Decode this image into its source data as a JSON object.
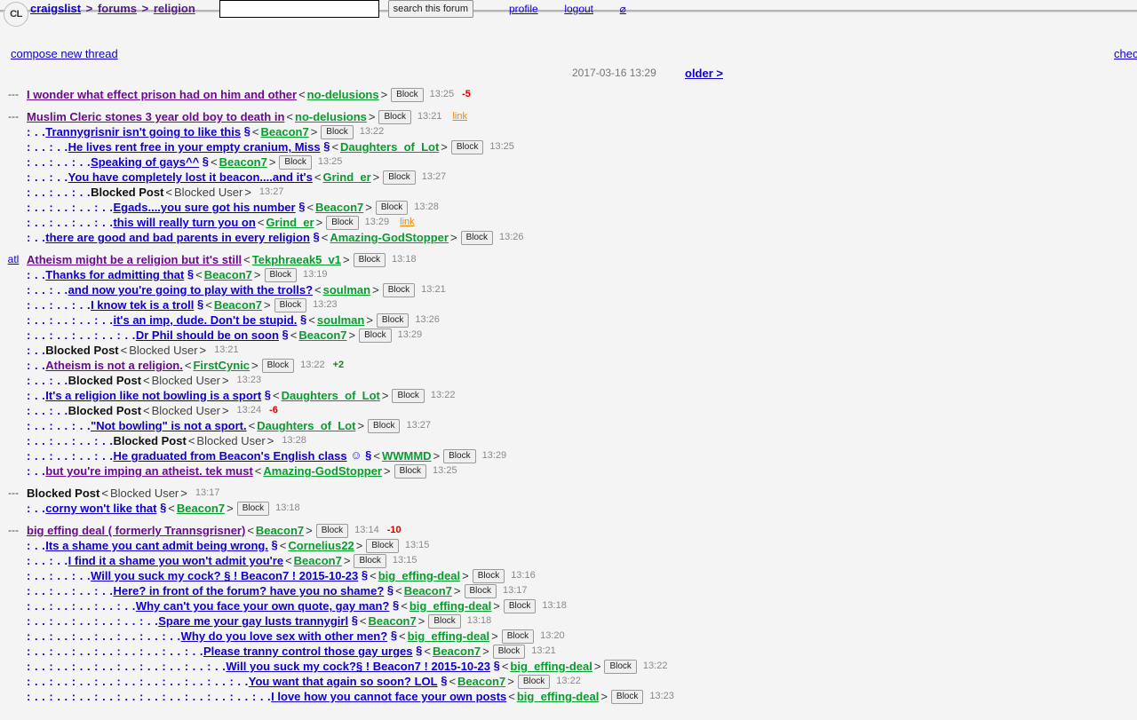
{
  "header": {
    "logo": "CL",
    "breadcrumbs": [
      {
        "label": "craigslist",
        "visited": false
      },
      {
        "label": "forums",
        "visited": true
      },
      {
        "label": "religion",
        "visited": true
      }
    ],
    "separator": ">",
    "search": {
      "value": "",
      "placeholder": "",
      "button_label": "search this forum"
    },
    "account_links": [
      {
        "label": "profile"
      },
      {
        "label": "logout"
      },
      {
        "label": "⌀"
      }
    ]
  },
  "subbar": {
    "compose_label": "compose new thread",
    "check_label": "chec",
    "timestamp": "2017-03-16 13:29",
    "older_label": "older >"
  },
  "glyphs": {
    "section": "§",
    "smiley": "☺",
    "open": "<",
    "close": ">",
    "block_label": "Block",
    "link_label": "link",
    "blocked_post": "Blocked Post",
    "blocked_user": "Blocked User",
    "dash": "---"
  },
  "threads": [
    {
      "posts": [
        {
          "flag": "---",
          "flag_link": false,
          "indent": "",
          "title": "I wonder what effect prison had on him and other",
          "visited": true,
          "section": false,
          "author": "no-delusions",
          "block": true,
          "time": "13:25",
          "score": "-5",
          "score_sign": "neg",
          "link": false
        }
      ]
    },
    {
      "posts": [
        {
          "flag": "---",
          "flag_link": false,
          "indent": "",
          "title": "Muslim Cleric stones 3 year old boy to death in",
          "visited": true,
          "section": false,
          "author": "no-delusions",
          "block": true,
          "time": "13:21",
          "score": "",
          "score_sign": "",
          "link": true
        },
        {
          "flag": "",
          "flag_link": false,
          "indent": ": . .",
          "title": "Trannygrisnir isn't going to like this",
          "visited": false,
          "section": true,
          "author": "Beacon7",
          "block": true,
          "time": "13:22",
          "score": "",
          "score_sign": "",
          "link": false
        },
        {
          "flag": "",
          "flag_link": false,
          "indent": ": . . : . .",
          "title": "He lives rent free in your empty cranium, Miss",
          "visited": false,
          "section": true,
          "author": "Daughters_of_Lot",
          "block": true,
          "time": "13:25",
          "score": "",
          "score_sign": "",
          "link": false
        },
        {
          "flag": "",
          "flag_link": false,
          "indent": ": . . : . . : . .",
          "title": "Speaking of gays^^",
          "visited": false,
          "section": true,
          "author": "Beacon7",
          "block": true,
          "time": "13:25",
          "score": "",
          "score_sign": "",
          "link": false
        },
        {
          "flag": "",
          "flag_link": false,
          "indent": ": . . : . .",
          "title": "You have completely lost it beacon....and it's",
          "visited": false,
          "section": false,
          "author": "Grind_er",
          "block": true,
          "time": "13:27",
          "score": "",
          "score_sign": "",
          "link": false
        },
        {
          "flag": "",
          "flag_link": false,
          "indent": ": . . : . . : . .",
          "title": "Blocked Post",
          "blocked": true,
          "visited": false,
          "section": false,
          "author": "Blocked User",
          "block": false,
          "time": "13:27",
          "score": "",
          "score_sign": "",
          "link": false
        },
        {
          "flag": "",
          "flag_link": false,
          "indent": ": . . : . . : . . : . .",
          "title": "Egads....you sure got his number",
          "visited": false,
          "section": true,
          "author": "Beacon7",
          "block": true,
          "time": "13:28",
          "score": "",
          "score_sign": "",
          "link": false
        },
        {
          "flag": "",
          "flag_link": false,
          "indent": ": . . : . . : . . : . .",
          "title": "this will really turn you on",
          "visited": false,
          "section": false,
          "author": "Grind_er",
          "block": true,
          "time": "13:29",
          "score": "",
          "score_sign": "",
          "link": true
        },
        {
          "flag": "",
          "flag_link": false,
          "indent": ": . .",
          "title": "there are good and bad parents in every religion",
          "visited": false,
          "section": true,
          "author": "Amazing-GodStopper",
          "block": true,
          "time": "13:26",
          "score": "",
          "score_sign": "",
          "link": false
        }
      ]
    },
    {
      "posts": [
        {
          "flag": "atl",
          "flag_link": true,
          "indent": "",
          "title": "Atheism might be a religion but it's still",
          "visited": true,
          "section": false,
          "author": "Tekphraeak5_v1",
          "block": true,
          "time": "13:18",
          "score": "",
          "score_sign": "",
          "link": false
        },
        {
          "flag": "",
          "flag_link": false,
          "indent": ": . .",
          "title": "Thanks for admitting that",
          "visited": false,
          "section": true,
          "author": "Beacon7",
          "block": true,
          "time": "13:19",
          "score": "",
          "score_sign": "",
          "link": false
        },
        {
          "flag": "",
          "flag_link": false,
          "indent": ": . . : . .",
          "title": "and now you're going to play with the trolls?",
          "visited": false,
          "section": false,
          "author": "soulman",
          "block": true,
          "time": "13:21",
          "score": "",
          "score_sign": "",
          "link": false
        },
        {
          "flag": "",
          "flag_link": false,
          "indent": ": . . : . . : . .",
          "title": "I know tek is a troll",
          "visited": false,
          "section": true,
          "author": "Beacon7",
          "block": true,
          "time": "13:23",
          "score": "",
          "score_sign": "",
          "link": false
        },
        {
          "flag": "",
          "flag_link": false,
          "indent": ": . . : . . : . . : . .",
          "title": "it's an imp, dude. Don't be stupid.",
          "visited": false,
          "section": true,
          "author": "soulman",
          "block": true,
          "time": "13:26",
          "score": "",
          "score_sign": "",
          "link": false
        },
        {
          "flag": "",
          "flag_link": false,
          "indent": ": . . : . . : . . : . . : . .",
          "title": "Dr Phil should be on soon",
          "visited": false,
          "section": true,
          "author": "Beacon7",
          "block": true,
          "time": "13:29",
          "score": "",
          "score_sign": "",
          "link": false
        },
        {
          "flag": "",
          "flag_link": false,
          "indent": ": . .",
          "title": "Blocked Post",
          "blocked": true,
          "visited": false,
          "section": false,
          "author": "Blocked User",
          "block": false,
          "time": "13:21",
          "score": "",
          "score_sign": "",
          "link": false
        },
        {
          "flag": "",
          "flag_link": false,
          "indent": ": . .",
          "title": "Atheism is not a religion.",
          "visited": true,
          "section": false,
          "author": "FirstCynic",
          "block": true,
          "time": "13:22",
          "score": "+2",
          "score_sign": "pos",
          "link": false
        },
        {
          "flag": "",
          "flag_link": false,
          "indent": ": . . : . .",
          "title": "Blocked Post",
          "blocked": true,
          "visited": false,
          "section": false,
          "author": "Blocked User",
          "block": false,
          "time": "13:23",
          "score": "",
          "score_sign": "",
          "link": false
        },
        {
          "flag": "",
          "flag_link": false,
          "indent": ": . .",
          "title": "It's a religion like not bowling is a sport",
          "visited": false,
          "section": true,
          "author": "Daughters_of_Lot",
          "block": true,
          "time": "13:22",
          "score": "",
          "score_sign": "",
          "link": false
        },
        {
          "flag": "",
          "flag_link": false,
          "indent": ": . . : . .",
          "title": "Blocked Post",
          "blocked": true,
          "visited": false,
          "section": false,
          "author": "Blocked User",
          "block": false,
          "time": "13:24",
          "score": "-6",
          "score_sign": "neg",
          "link": false
        },
        {
          "flag": "",
          "flag_link": false,
          "indent": ": . . : . . : . .",
          "title": "\"Not bowling\" is not a sport.",
          "visited": false,
          "section": false,
          "author": "Daughters_of_Lot",
          "block": true,
          "time": "13:27",
          "score": "",
          "score_sign": "",
          "link": false
        },
        {
          "flag": "",
          "flag_link": false,
          "indent": ": . . : . . : . . : . .",
          "title": "Blocked Post",
          "blocked": true,
          "visited": false,
          "section": false,
          "author": "Blocked User",
          "block": false,
          "time": "13:28",
          "score": "",
          "score_sign": "",
          "link": false
        },
        {
          "flag": "",
          "flag_link": false,
          "indent": ": . . : . . : . . : . .",
          "title": "He graduated from Beacon's English class",
          "visited": false,
          "section": true,
          "smiley": true,
          "author": "WWMMD",
          "block": true,
          "time": "13:29",
          "score": "",
          "score_sign": "",
          "link": false
        },
        {
          "flag": "",
          "flag_link": false,
          "indent": ": . .",
          "title": "but you're imping an atheist. tek must",
          "visited": true,
          "section": false,
          "author": "Amazing-GodStopper",
          "block": true,
          "time": "13:25",
          "score": "",
          "score_sign": "",
          "link": false
        }
      ]
    },
    {
      "posts": [
        {
          "flag": "---",
          "flag_link": false,
          "indent": "",
          "title": "Blocked Post",
          "blocked": true,
          "visited": false,
          "section": false,
          "author": "Blocked User",
          "block": false,
          "time": "13:17",
          "score": "",
          "score_sign": "",
          "link": false
        },
        {
          "flag": "",
          "flag_link": false,
          "indent": ": . .",
          "title": "corny won't like that",
          "visited": false,
          "section": true,
          "author": "Beacon7",
          "block": true,
          "time": "13:18",
          "score": "",
          "score_sign": "",
          "link": false
        }
      ]
    },
    {
      "posts": [
        {
          "flag": "---",
          "flag_link": false,
          "indent": "",
          "title": "big effing deal ( formerly Trannsgrisner)",
          "visited": true,
          "section": false,
          "author": "Beacon7",
          "block": true,
          "time": "13:14",
          "score": "-10",
          "score_sign": "neg",
          "link": false
        },
        {
          "flag": "",
          "flag_link": false,
          "indent": ": . .",
          "title": "Its a shame you cant admit being wrong.",
          "visited": false,
          "section": true,
          "author": "Cornelius22",
          "block": true,
          "time": "13:15",
          "score": "",
          "score_sign": "",
          "link": false
        },
        {
          "flag": "",
          "flag_link": false,
          "indent": ": . . : . .",
          "title": "I find it a shame you won't admit you're",
          "visited": false,
          "section": false,
          "author": "Beacon7",
          "block": true,
          "time": "13:15",
          "score": "",
          "score_sign": "",
          "link": false
        },
        {
          "flag": "",
          "flag_link": false,
          "indent": ": . . : . . : . .",
          "title": "Will you suck my cock? § ! Beacon7 ! 2015-10-23",
          "visited": false,
          "section": true,
          "author": "big_effing-deal",
          "block": true,
          "time": "13:16",
          "score": "",
          "score_sign": "",
          "link": false
        },
        {
          "flag": "",
          "flag_link": false,
          "indent": ": . . : . . : . . : . .",
          "title": "Here? in front of the forum? have you no shame?",
          "visited": false,
          "section": true,
          "author": "Beacon7",
          "block": true,
          "time": "13:17",
          "score": "",
          "score_sign": "",
          "link": false
        },
        {
          "flag": "",
          "flag_link": false,
          "indent": ": . . : . . : . . : . . : . .",
          "title": "Why can't you face your own quote, gay man?",
          "visited": false,
          "section": true,
          "author": "big_effing-deal",
          "block": true,
          "time": "13:18",
          "score": "",
          "score_sign": "",
          "link": false
        },
        {
          "flag": "",
          "flag_link": false,
          "indent": ": . . : . . : . . : . . : . . : . .",
          "title": "Spare me your gay lusts trannygirl",
          "visited": false,
          "section": true,
          "author": "Beacon7",
          "block": true,
          "time": "13:18",
          "score": "",
          "score_sign": "",
          "link": false
        },
        {
          "flag": "",
          "flag_link": false,
          "indent": ": . . : . . : . . : . . : . . : . . : . .",
          "title": "Why do you love sex with other men?",
          "visited": false,
          "section": true,
          "author": "big_effing-deal",
          "block": true,
          "time": "13:20",
          "score": "",
          "score_sign": "",
          "link": false
        },
        {
          "flag": "",
          "flag_link": false,
          "indent": ": . . : . . : . . : . . : . . : . . : . . : . .",
          "title": "Please tranny control those gay urges",
          "visited": false,
          "section": true,
          "author": "Beacon7",
          "block": true,
          "time": "13:21",
          "score": "",
          "score_sign": "",
          "link": false
        },
        {
          "flag": "",
          "flag_link": false,
          "indent": ": . . : . . : . . : . . : . . : . . : . . : . . : . .",
          "title": "Will you suck my cock?§ ! Beacon7 ! 2015-10-23",
          "visited": false,
          "section": true,
          "author": "big_effing-deal",
          "block": true,
          "time": "13:22",
          "score": "",
          "score_sign": "",
          "link": false
        },
        {
          "flag": "",
          "flag_link": false,
          "indent": ": . . : . . : . . : . . : . . : . . : . . : . . : . . : . .",
          "title": "You want that again so soon? LOL",
          "visited": false,
          "section": true,
          "author": "Beacon7",
          "block": true,
          "time": "13:22",
          "score": "",
          "score_sign": "",
          "link": false
        },
        {
          "flag": "",
          "flag_link": false,
          "indent": ": . . : . . : . . : . . : . . : . . : . . : . . : . . : . . : . .",
          "title": "I love how you cannot face your own posts",
          "visited": false,
          "section": false,
          "author": "big_effing-deal",
          "block": true,
          "time": "13:23",
          "score": "",
          "score_sign": "",
          "link": false
        }
      ]
    }
  ]
}
